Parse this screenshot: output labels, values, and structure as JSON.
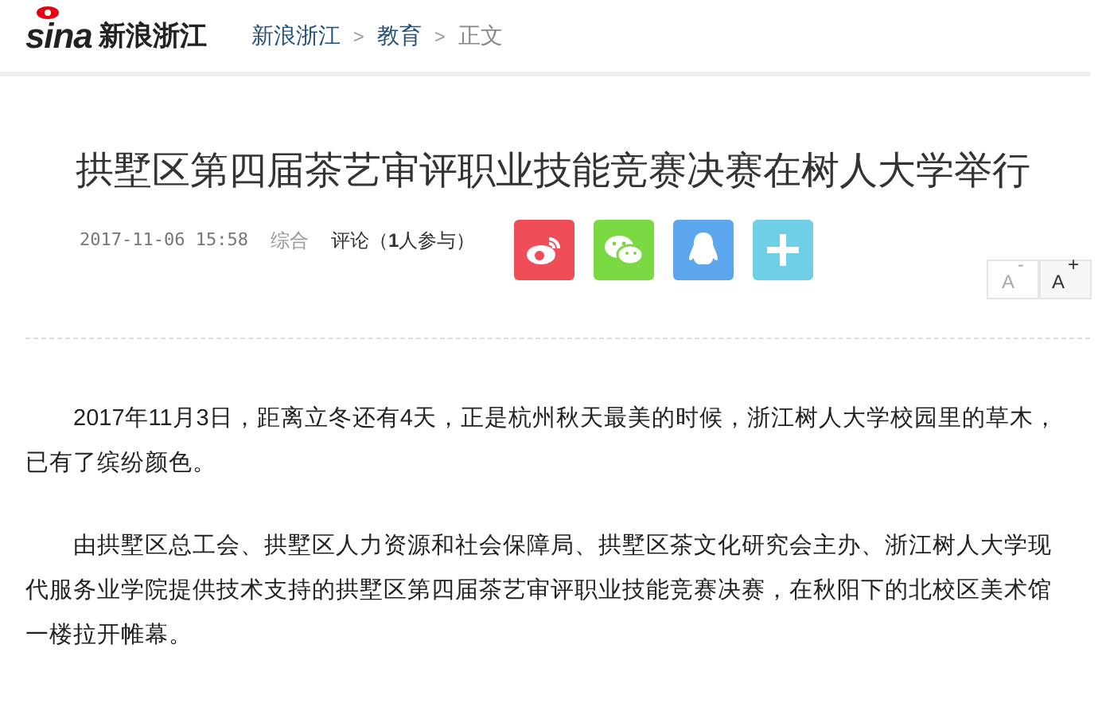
{
  "logo": {
    "wordmark": "sina",
    "site": "新浪浙江"
  },
  "breadcrumb": [
    {
      "label": "新浪浙江",
      "link": true
    },
    {
      "label": "教育",
      "link": true
    },
    {
      "label": "正文",
      "link": false
    }
  ],
  "separator": ">",
  "title": "拱墅区第四届茶艺审评职业技能竞赛决赛在树人大学举行",
  "meta": {
    "date": "2017-11-06 15:58",
    "channel": "综合",
    "comments": "评论（**1**人参与）"
  },
  "share": [
    {
      "kind": "weibo",
      "color": "#ef4d58"
    },
    {
      "kind": "wechat",
      "color": "#7ad942"
    },
    {
      "kind": "qq",
      "color": "#5ba6ec"
    },
    {
      "kind": "more",
      "color": "#6fcfe6"
    }
  ],
  "font_buttons": [
    {
      "label": "A",
      "sign": "-",
      "disabled": true
    },
    {
      "label": "A",
      "sign": "+",
      "disabled": false
    }
  ],
  "paragraphs": [
    "2017年11月3日，距离立冬还有4天，正是杭州秋天最美的时候，浙江树人大学校园里的草木，已有了缤纷颜色。",
    "由拱墅区总工会、拱墅区人力资源和社会保障局、拱墅区茶文化研究会主办、浙江树人大学现代服务业学院提供技术支持的拱墅区第四届茶艺审评职业技能竞赛决赛，在秋阳下的北校区美术馆一楼拉开帷幕。"
  ]
}
